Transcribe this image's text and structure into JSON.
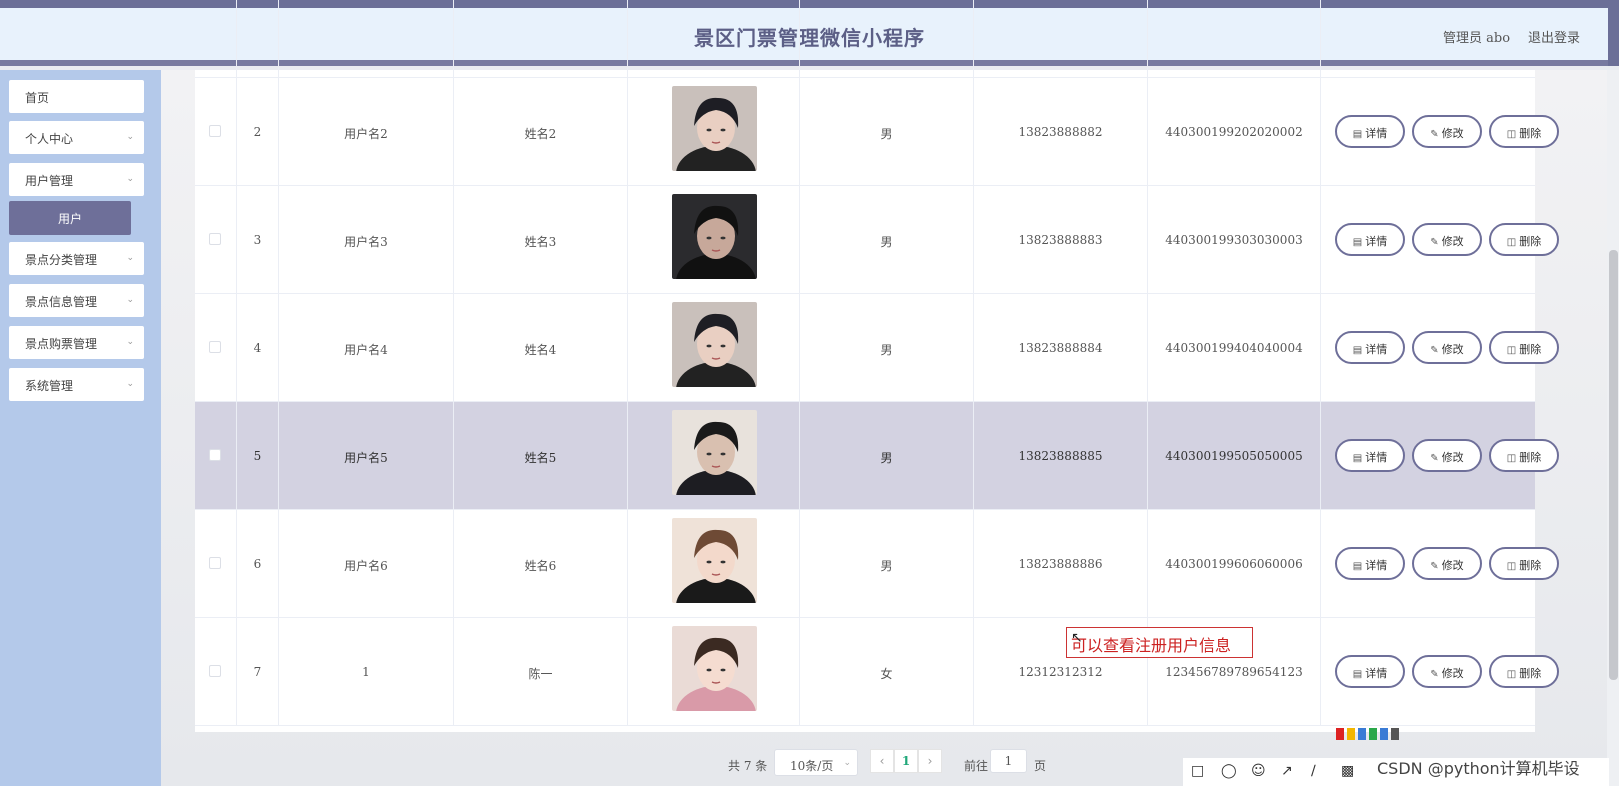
{
  "header": {
    "title": "景区门票管理微信小程序",
    "admin": "管理员 abo",
    "logout": "退出登录"
  },
  "sidebar": {
    "items": [
      {
        "label": "首页",
        "has_chevron": false
      },
      {
        "label": "个人中心",
        "has_chevron": true
      },
      {
        "label": "用户管理",
        "has_chevron": true
      },
      {
        "label": "景点分类管理",
        "has_chevron": true
      },
      {
        "label": "景点信息管理",
        "has_chevron": true
      },
      {
        "label": "景点购票管理",
        "has_chevron": true
      },
      {
        "label": "系统管理",
        "has_chevron": true
      }
    ],
    "active_sub": "用户"
  },
  "table": {
    "rows": [
      {
        "no": "2",
        "username": "用户名2",
        "name": "姓名2",
        "gender": "男",
        "phone": "13823888882",
        "idcard": "440300199202020002"
      },
      {
        "no": "3",
        "username": "用户名3",
        "name": "姓名3",
        "gender": "男",
        "phone": "13823888883",
        "idcard": "440300199303030003"
      },
      {
        "no": "4",
        "username": "用户名4",
        "name": "姓名4",
        "gender": "男",
        "phone": "13823888884",
        "idcard": "440300199404040004"
      },
      {
        "no": "5",
        "username": "用户名5",
        "name": "姓名5",
        "gender": "男",
        "phone": "13823888885",
        "idcard": "440300199505050005"
      },
      {
        "no": "6",
        "username": "用户名6",
        "name": "姓名6",
        "gender": "男",
        "phone": "13823888886",
        "idcard": "440300199606060006"
      },
      {
        "no": "7",
        "username": "1",
        "name": "陈一",
        "gender": "女",
        "phone": "12312312312",
        "idcard": "123456789789654123"
      }
    ],
    "actions": {
      "detail": "详情",
      "edit": "修改",
      "delete": "删除"
    }
  },
  "annotation": "可以查看注册用户信息",
  "pagination": {
    "total": "共 7 条",
    "page_size": "10条/页",
    "current_page": "1",
    "goto_label": "前往",
    "goto_value": "1",
    "page_unit": "页"
  },
  "watermark": "CSDN @python计算机毕设",
  "colors": {
    "accent": "#6e6f99",
    "sidebar": "#b4c9ea",
    "header_bg": "#e8f2fc",
    "highlight_row": "#d3d2e1"
  }
}
